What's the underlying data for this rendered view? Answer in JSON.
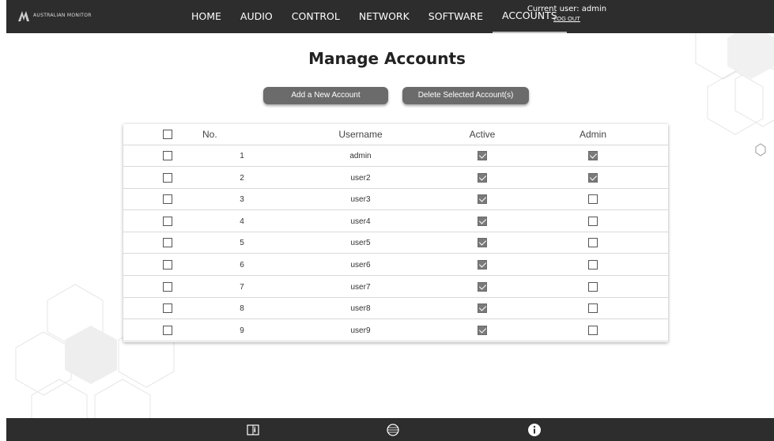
{
  "brand": {
    "logo_text": "AUSTRALIAN MONITOR"
  },
  "nav": {
    "items": [
      {
        "label": "HOME",
        "active": false
      },
      {
        "label": "AUDIO",
        "active": false
      },
      {
        "label": "CONTROL",
        "active": false
      },
      {
        "label": "NETWORK",
        "active": false
      },
      {
        "label": "SOFTWARE",
        "active": false
      },
      {
        "label": "ACCOUNTS",
        "active": true
      }
    ]
  },
  "user": {
    "current_label": "Current user: admin",
    "logout_label": "LOG OUT"
  },
  "page": {
    "title": "Manage Accounts"
  },
  "actions": {
    "add_label": "Add a New Account",
    "delete_label": "Delete Selected Account(s)"
  },
  "table": {
    "headers": {
      "no": "No.",
      "username": "Username",
      "active": "Active",
      "admin": "Admin"
    },
    "rows": [
      {
        "no": "1",
        "username": "admin",
        "active": true,
        "admin": true,
        "selected": false
      },
      {
        "no": "2",
        "username": "user2",
        "active": true,
        "admin": true,
        "selected": false
      },
      {
        "no": "3",
        "username": "user3",
        "active": true,
        "admin": false,
        "selected": false
      },
      {
        "no": "4",
        "username": "user4",
        "active": true,
        "admin": false,
        "selected": false
      },
      {
        "no": "5",
        "username": "user5",
        "active": true,
        "admin": false,
        "selected": false
      },
      {
        "no": "6",
        "username": "user6",
        "active": true,
        "admin": false,
        "selected": false
      },
      {
        "no": "7",
        "username": "user7",
        "active": true,
        "admin": false,
        "selected": false
      },
      {
        "no": "8",
        "username": "user8",
        "active": true,
        "admin": false,
        "selected": false
      },
      {
        "no": "9",
        "username": "user9",
        "active": true,
        "admin": false,
        "selected": false
      }
    ]
  },
  "footer": {
    "icons": [
      "manual-icon",
      "globe-icon",
      "info-icon"
    ]
  },
  "colors": {
    "topbar": "#2d2d2d",
    "button": "#6b6b6b",
    "checked": "#7a7a7a"
  }
}
